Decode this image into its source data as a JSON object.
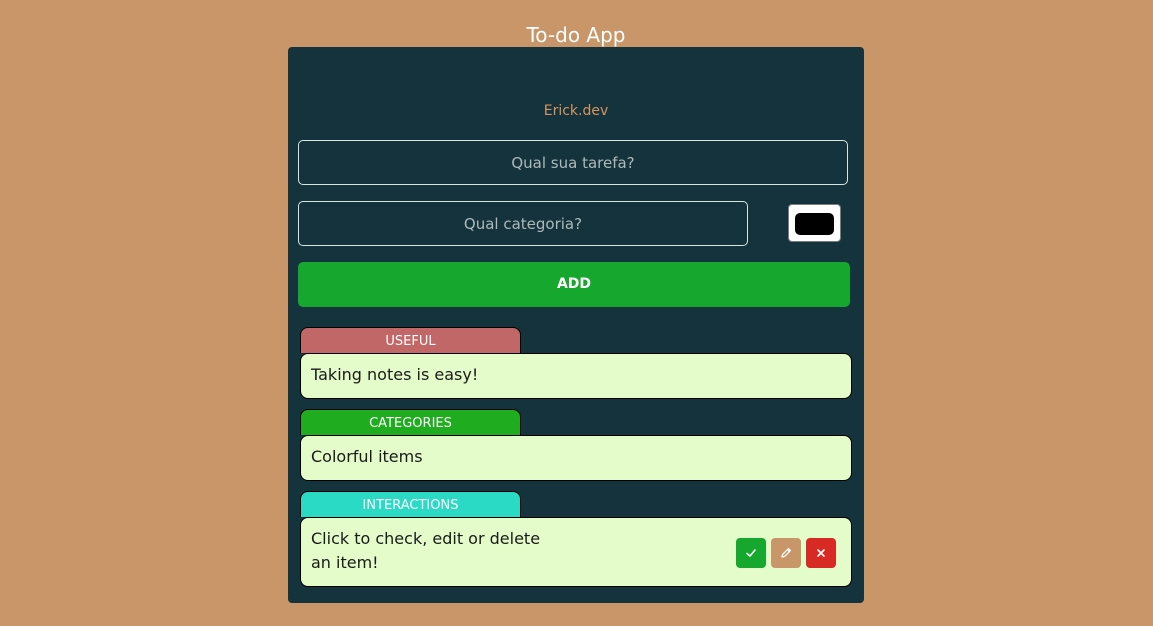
{
  "app": {
    "title": "To-do App",
    "subtitle": "Erick.dev"
  },
  "form": {
    "task_placeholder": "Qual sua tarefa?",
    "category_placeholder": "Qual categoria?",
    "color_value": "#000000",
    "add_label": "ADD"
  },
  "items": [
    {
      "category": "USEFUL",
      "category_color": "#c26767",
      "text": "Taking notes is easy!"
    },
    {
      "category": "CATEGORIES",
      "category_color": "#1fac1f",
      "text": "Colorful items"
    },
    {
      "category": "INTERACTIONS",
      "category_color": "#2bdac5",
      "text": "Click to check, edit or delete an item!",
      "actions": [
        "check-icon",
        "pencil-icon",
        "close-icon"
      ]
    }
  ],
  "colors": {
    "background": "#c89668",
    "panel": "#14333c",
    "accent": "#d6955c",
    "add_button": "#16a72e",
    "item_body": "#e4fcca",
    "delete": "#d82a25"
  }
}
